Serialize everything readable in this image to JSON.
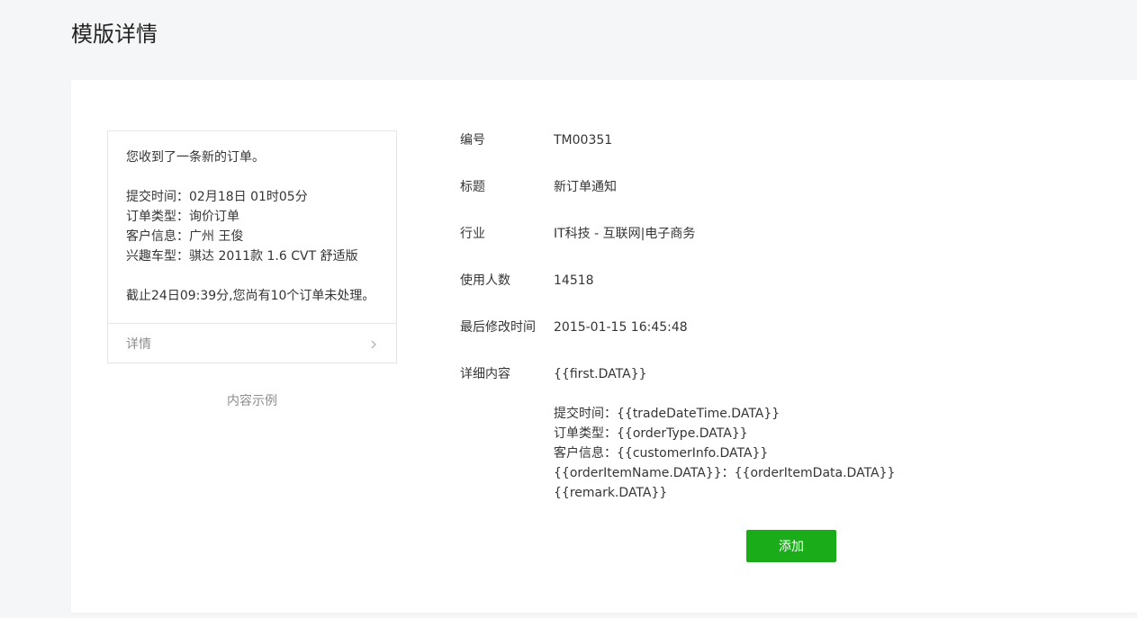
{
  "page": {
    "title": "模版详情"
  },
  "preview": {
    "lines_top": [
      "您收到了一条新的订单。"
    ],
    "lines_mid": [
      "提交时间：02月18日 01时05分",
      "订单类型：询价订单",
      "客户信息：广州 王俊",
      "兴趣车型：骐达 2011款 1.6 CVT 舒适版"
    ],
    "lines_bottom": [
      "截止24日09:39分,您尚有10个订单未处理。"
    ],
    "detail_label": "详情",
    "chevron_icon": "chevron-right-icon",
    "caption": "内容示例"
  },
  "info": {
    "id_label": "编号",
    "id_value": "TM00351",
    "title_label": "标题",
    "title_value": "新订单通知",
    "industry_label": "行业",
    "industry_value": "IT科技 - 互联网|电子商务",
    "users_label": "使用人数",
    "users_value": "14518",
    "modified_label": "最后修改时间",
    "modified_value": "2015-01-15 16:45:48",
    "content_label": "详细内容",
    "content_first": "{{first.DATA}}",
    "content_lines": [
      "提交时间：{{tradeDateTime.DATA}}",
      "订单类型：{{orderType.DATA}}",
      "客户信息：{{customerInfo.DATA}}",
      "{{orderItemName.DATA}}：{{orderItemData.DATA}}",
      "{{remark.DATA}}"
    ]
  },
  "actions": {
    "add_label": "添加"
  },
  "colors": {
    "primary_button": "#1aad19",
    "background": "#f5f6f7",
    "panel": "#ffffff"
  }
}
